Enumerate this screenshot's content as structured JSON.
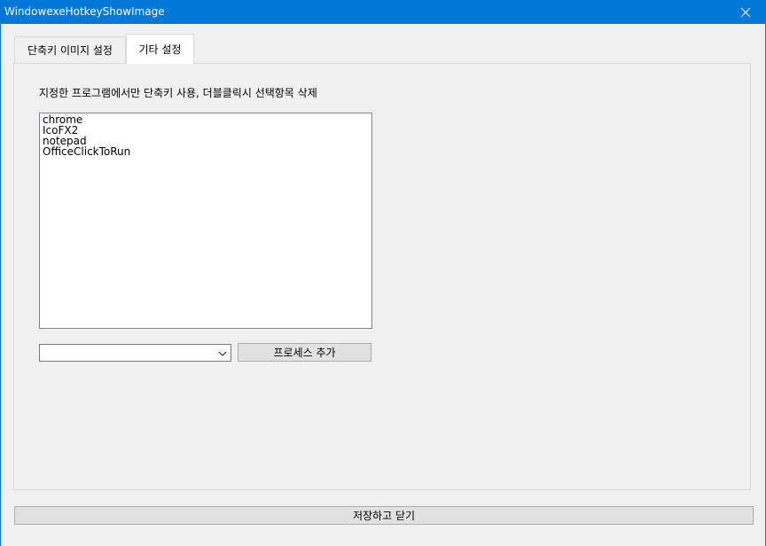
{
  "window": {
    "title": "WindowexeHotkeyShowImage"
  },
  "tabs": [
    {
      "label": "단축키 이미지 설정"
    },
    {
      "label": "기타 설정"
    }
  ],
  "settings": {
    "description": "지정한 프로그램에서만 단축키 사용, 더블클릭시 선택항목 삭제",
    "processes": [
      "chrome",
      "IcoFX2",
      "notepad",
      "OfficeClickToRun"
    ],
    "process_select_value": "",
    "add_process_label": "프로세스 추가"
  },
  "footer": {
    "save_close_label": "저장하고 닫기"
  }
}
